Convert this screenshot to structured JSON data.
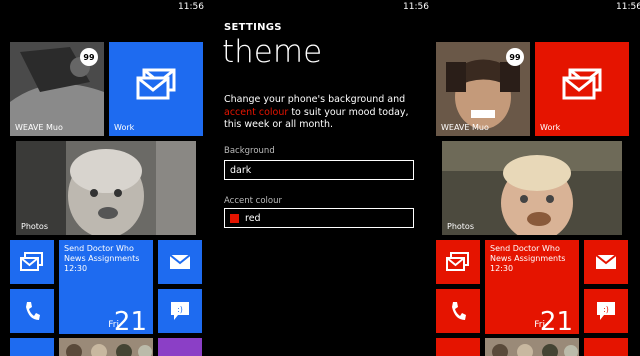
{
  "colors": {
    "blue_accent": "#1e6bf0",
    "red_accent": "#e51400",
    "purple_tile": "#8b3fc6",
    "background": "#000000"
  },
  "left": {
    "clock": "11:56",
    "tiles": {
      "people_label": "WEAVE Muo",
      "people_badge": "99",
      "work_label": "Work",
      "photos_label": "Photos",
      "calendar_line1": "Send Doctor Who",
      "calendar_line2": "News Assignments",
      "calendar_line3": "12:30",
      "calendar_day": "Fri",
      "calendar_date": "21"
    },
    "icons": [
      "mail-icon",
      "phone-icon",
      "message-icon",
      "envelope-icon"
    ]
  },
  "settings": {
    "clock": "11:56",
    "section": "SETTINGS",
    "heading": "theme",
    "desc_before": "Change your phone's background and ",
    "desc_link": "accent colour",
    "desc_after": " to suit your mood today, this week or all month.",
    "background_label": "Background",
    "background_value": "dark",
    "accent_label": "Accent colour",
    "accent_value": "red"
  },
  "right": {
    "clock": "11:56",
    "tiles": {
      "people_label": "WEAVE Muo",
      "people_badge": "99",
      "work_label": "Work",
      "photos_label": "Photos",
      "calendar_line1": "Send Doctor Who",
      "calendar_line2": "News Assignments",
      "calendar_line3": "12:30",
      "calendar_day": "Fri",
      "calendar_date": "21"
    }
  }
}
